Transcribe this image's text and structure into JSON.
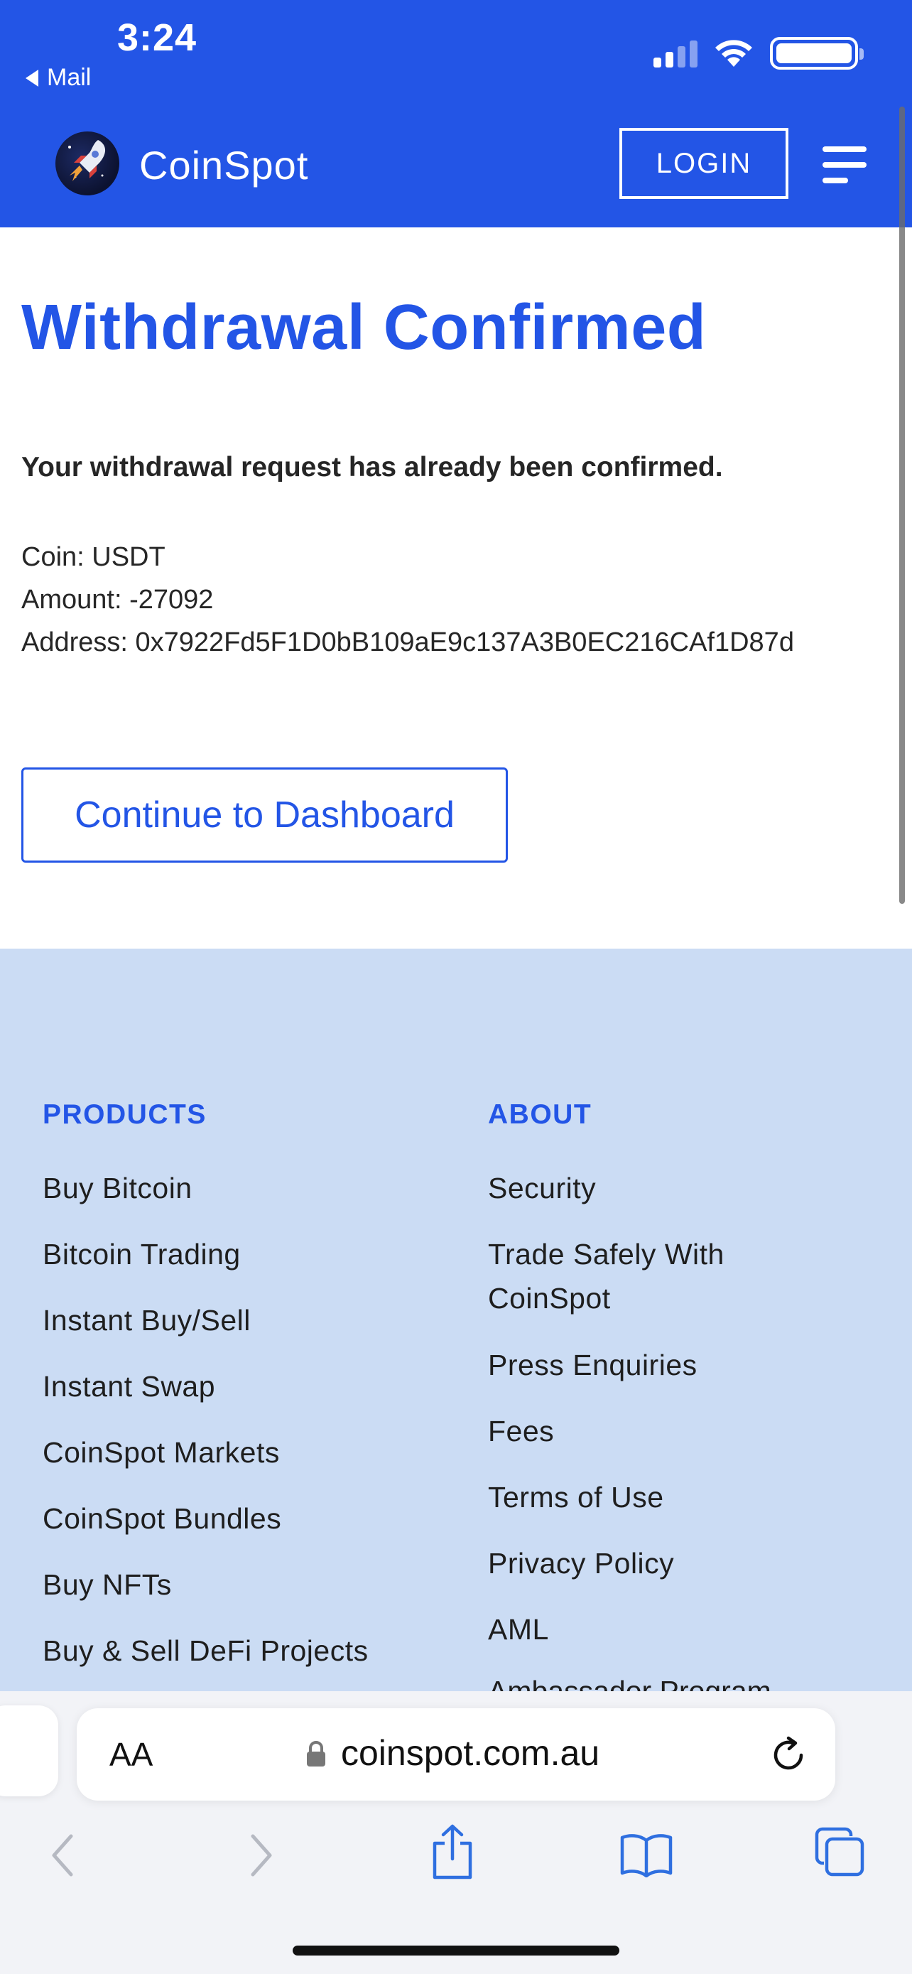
{
  "status_bar": {
    "time": "3:24",
    "back_label": "Mail"
  },
  "header": {
    "brand": "CoinSpot",
    "login_label": "LOGIN",
    "accent_color": "#2355e6"
  },
  "main": {
    "title": "Withdrawal Confirmed",
    "notice": "Your withdrawal request has already been confirmed.",
    "details": [
      "Coin: USDT",
      "Amount: -27092",
      "Address: 0x7922Fd5F1D0bB109aE9c137A3B0EC216CAf1D87d"
    ],
    "continue_label": "Continue to Dashboard"
  },
  "footer": {
    "products": {
      "heading": "PRODUCTS",
      "links": [
        "Buy Bitcoin",
        "Bitcoin Trading",
        "Instant Buy/Sell",
        "Instant Swap",
        "CoinSpot Markets",
        "CoinSpot Bundles",
        "Buy NFTs",
        "Buy & Sell DeFi Projects"
      ]
    },
    "about": {
      "heading": "ABOUT",
      "links": [
        "Security",
        "Trade Safely With CoinSpot",
        "Press Enquiries",
        "Fees",
        "Terms of Use",
        "Privacy Policy",
        "AML"
      ],
      "partial_link": "Ambassador Program"
    }
  },
  "browser": {
    "aa_label": "AA",
    "url": "coinspot.com.au"
  },
  "icons": {
    "back": "back-arrow-icon",
    "forward": "forward-arrow-icon",
    "share": "share-icon",
    "bookmarks": "bookmarks-icon",
    "tabs": "tabs-icon",
    "reload": "reload-icon",
    "lock": "lock-icon"
  }
}
